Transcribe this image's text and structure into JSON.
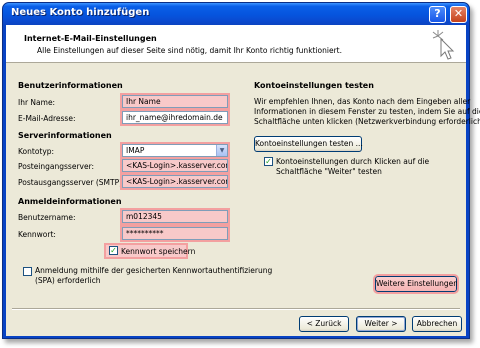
{
  "window": {
    "title": "Neues Konto hinzufügen",
    "help_glyph": "?",
    "close_glyph": "✕"
  },
  "header": {
    "title": "Internet-E-Mail-Einstellungen",
    "subtitle": "Alle Einstellungen auf dieser Seite sind nötig, damit Ihr Konto richtig funktioniert."
  },
  "user_info": {
    "heading": "Benutzerinformationen",
    "name_label": "Ihr Name:",
    "name_value": "Ihr Name",
    "email_label": "E-Mail-Adresse:",
    "email_value": "ihr_name@ihredomain.de"
  },
  "server_info": {
    "heading": "Serverinformationen",
    "account_type_label": "Kontotyp:",
    "account_type_value": "IMAP",
    "incoming_label": "Posteingangsserver:",
    "incoming_value": "<KAS-Login>.kasserver.com",
    "outgoing_label": "Postausgangsserver (SMTP):",
    "outgoing_value": "<KAS-Login>.kasserver.com"
  },
  "login_info": {
    "heading": "Anmeldeinformationen",
    "username_label": "Benutzername:",
    "username_value": "m012345",
    "password_label": "Kennwort:",
    "password_value": "**********",
    "remember_label": "Kennwort speichern",
    "remember_checked": true,
    "spa_label_line1": "Anmeldung mithilfe der gesicherten Kennwortauthentifizierung",
    "spa_label_line2": "(SPA) erforderlich",
    "spa_checked": false
  },
  "test_settings": {
    "heading": "Kontoeinstellungen testen",
    "description_line1": "Wir empfehlen Ihnen, das Konto nach dem Eingeben aller",
    "description_line2": "Informationen in diesem Fenster zu testen, indem Sie auf die",
    "description_line3": "Schaltfläche unten klicken (Netzwerkverbindung erforderlich).",
    "test_button_label": "Kontoeinstellungen testen ...",
    "auto_test_label_line1": "Kontoeinstellungen durch Klicken auf die",
    "auto_test_label_line2": "Schaltfläche \"Weiter\" testen",
    "auto_test_checked": true,
    "more_settings_label": "Weitere Einstellungen"
  },
  "footer": {
    "back_label": "< Zurück",
    "next_label": "Weiter >",
    "cancel_label": "Abbrechen"
  },
  "icons": {
    "checkmark": "✓",
    "dropdown": "▼"
  },
  "colors": {
    "highlight_fill": "#f8c9c9",
    "highlight_border": "#f3a0a0",
    "titlebar_blue": "#0654dd",
    "dialog_bg": "#ece9d8"
  }
}
